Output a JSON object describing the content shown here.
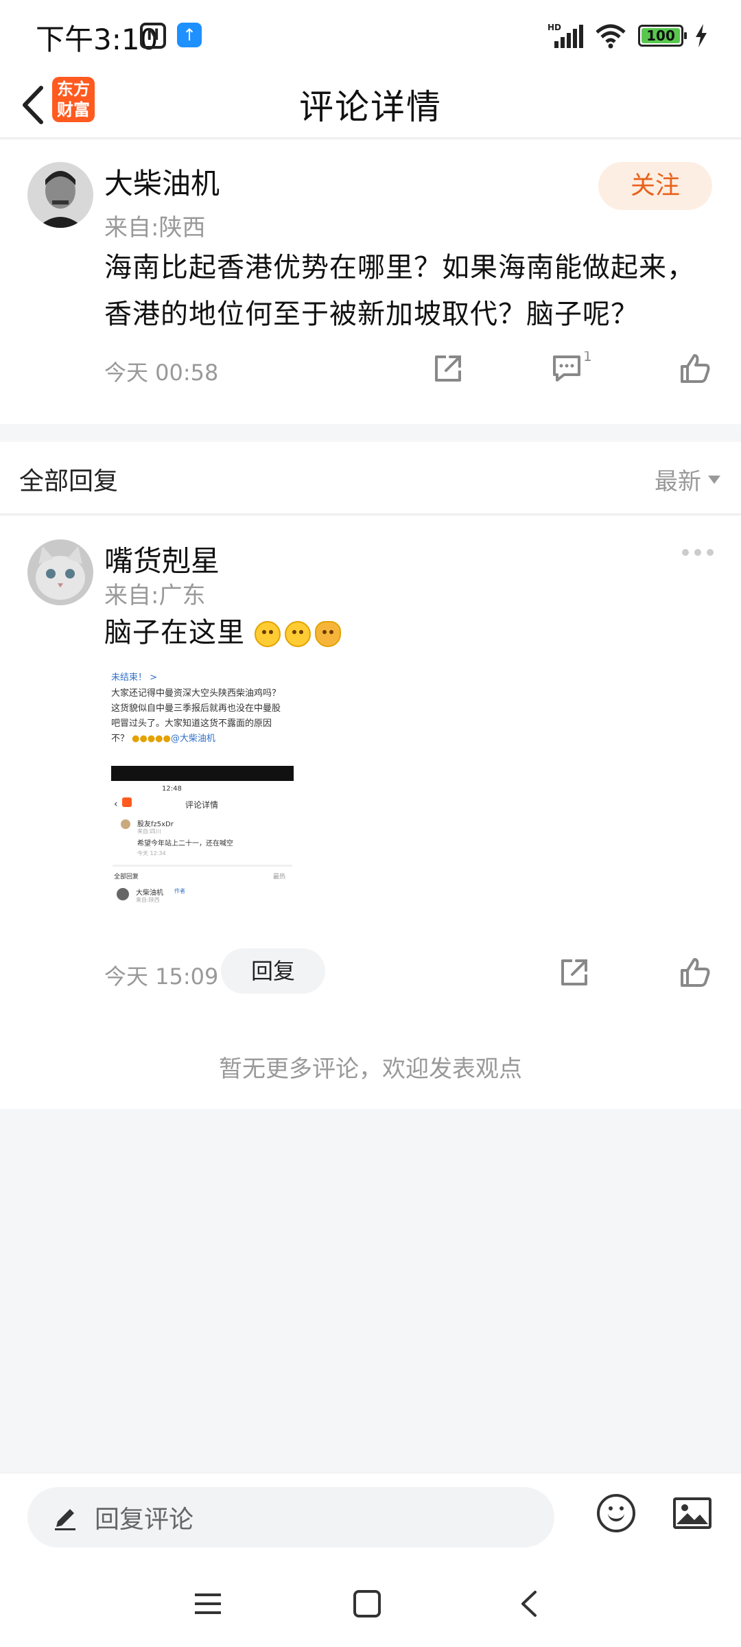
{
  "status_bar": {
    "time": "下午3:10",
    "nfc_icon": "nfc-icon",
    "app_notification_icon": "upload-arrow-icon",
    "network": "HD",
    "battery": "100"
  },
  "header": {
    "title": "评论详情",
    "logo_text_line1": "东方",
    "logo_text_line2": "财富"
  },
  "main_comment": {
    "username": "大柴油机",
    "location": "来自:陕西",
    "follow_label": "关注",
    "text_line1": "海南比起香港优势在哪里？如果海南能做起来，",
    "text_line2": "香港的地位何至于被新加坡取代？脑子呢？",
    "timestamp": "今天 00:58",
    "reply_count": "1"
  },
  "replies_section": {
    "title": "全部回复",
    "sort_label": "最新"
  },
  "reply": {
    "username": "嘴货剋星",
    "location": "来自:广东",
    "text": "脑子在这里",
    "timestamp": "今天 15:09",
    "reply_button_label": "回复",
    "screenshot": {
      "link_text": "未结束！ >",
      "body_line1": "大家还记得中曼资深大空头陕西柴油鸡吗？",
      "body_line2": "这货貌似自中曼三季报后就再也没在中曼股",
      "body_line3": "吧冒过头了。大家知道这货不露面的原因",
      "body_line4": "不？",
      "mention": "@大柴油机",
      "inner_time": "12:48",
      "inner_title": "评论详情",
      "inner_user": "股友fz5xDr",
      "inner_location": "来自:四川",
      "inner_text": "希望今年站上二十一，还在喊空",
      "inner_timestamp": "今天 12:34",
      "inner_section": "全部回复",
      "inner_sort": "最热",
      "inner_reply_user": "大柴油机",
      "inner_author_tag": "作者",
      "inner_reply_location": "来自:陕西"
    }
  },
  "footer_note": "暂无更多评论，欢迎发表观点",
  "input_bar": {
    "placeholder": "回复评论"
  },
  "colors": {
    "accent": "#e8621c",
    "follow_bg": "#fdeee3",
    "logo_bg": "#ff5a1f",
    "link": "#2f6fc7",
    "muted_text": "#999999",
    "page_bg": "#f5f6f8"
  }
}
